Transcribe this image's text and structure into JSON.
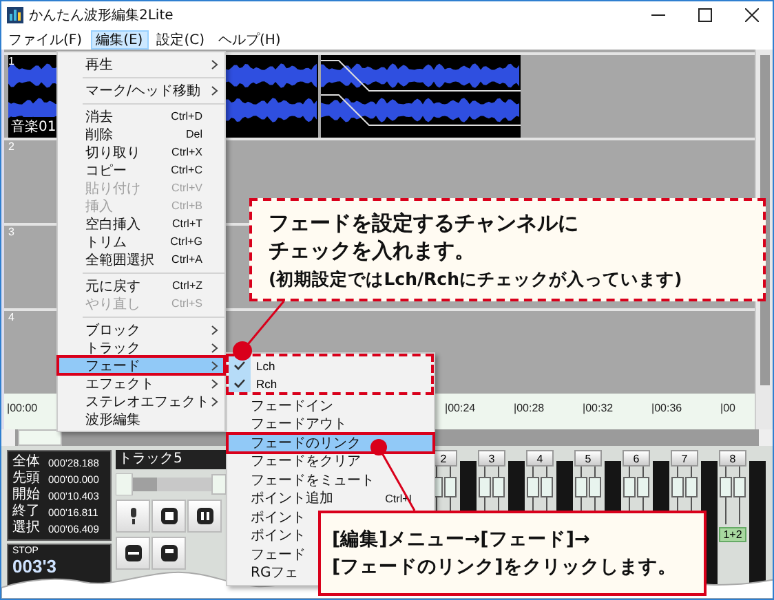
{
  "window": {
    "title": "かんたん波形編集2Lite"
  },
  "menu_bar": [
    {
      "label": "ファイル(F)",
      "selected": false
    },
    {
      "label": "編集(E)",
      "selected": true
    },
    {
      "label": "設定(C)",
      "selected": false
    },
    {
      "label": "ヘルプ(H)",
      "selected": false
    }
  ],
  "tracks": [
    {
      "number": "1",
      "kind": "audio",
      "name": "音楽01"
    },
    {
      "number": "2",
      "kind": "empty"
    },
    {
      "number": "3",
      "kind": "empty"
    },
    {
      "number": "4",
      "kind": "empty"
    }
  ],
  "ruler": [
    "|00:00",
    "|00:24",
    "|00:28",
    "|00:32",
    "|00:36",
    "|00"
  ],
  "info": [
    {
      "label": "全体",
      "value": "000'28.188"
    },
    {
      "label": "先頭",
      "value": "000'00.000"
    },
    {
      "label": "開始",
      "value": "000'10.403"
    },
    {
      "label": "終了",
      "value": "000'16.811"
    },
    {
      "label": "選択",
      "value": "000'06.409"
    }
  ],
  "transport": {
    "state": "STOP",
    "time": "003'3"
  },
  "track_panel": {
    "title": "トラック5"
  },
  "mixer": [
    {
      "channel": "2"
    },
    {
      "channel": "3"
    },
    {
      "channel": "4"
    },
    {
      "channel": "5"
    },
    {
      "channel": "6"
    },
    {
      "channel": "7"
    },
    {
      "channel": "8",
      "mode": "1+2"
    }
  ],
  "edit_menu": [
    {
      "kind": "item",
      "label": "再生",
      "submenu": true,
      "disabled": false,
      "selected": false
    },
    {
      "kind": "separator"
    },
    {
      "kind": "item",
      "label": "マーク/ヘッド移動",
      "submenu": true,
      "disabled": false,
      "selected": false
    },
    {
      "kind": "separator"
    },
    {
      "kind": "item",
      "label": "消去",
      "shortcut": "Ctrl+D",
      "disabled": false,
      "selected": false
    },
    {
      "kind": "item",
      "label": "削除",
      "shortcut": "Del",
      "disabled": false,
      "selected": false
    },
    {
      "kind": "item",
      "label": "切り取り",
      "shortcut": "Ctrl+X",
      "disabled": false,
      "selected": false
    },
    {
      "kind": "item",
      "label": "コピー",
      "shortcut": "Ctrl+C",
      "disabled": false,
      "selected": false
    },
    {
      "kind": "item",
      "label": "貼り付け",
      "shortcut": "Ctrl+V",
      "disabled": true,
      "selected": false
    },
    {
      "kind": "item",
      "label": "挿入",
      "shortcut": "Ctrl+B",
      "disabled": true,
      "selected": false
    },
    {
      "kind": "item",
      "label": "空白挿入",
      "shortcut": "Ctrl+T",
      "disabled": false,
      "selected": false
    },
    {
      "kind": "item",
      "label": "トリム",
      "shortcut": "Ctrl+G",
      "disabled": false,
      "selected": false
    },
    {
      "kind": "item",
      "label": "全範囲選択",
      "shortcut": "Ctrl+A",
      "disabled": false,
      "selected": false
    },
    {
      "kind": "separator"
    },
    {
      "kind": "item",
      "label": "元に戻す",
      "shortcut": "Ctrl+Z",
      "disabled": false,
      "selected": false
    },
    {
      "kind": "item",
      "label": "やり直し",
      "shortcut": "Ctrl+S",
      "disabled": true,
      "selected": false
    },
    {
      "kind": "separator"
    },
    {
      "kind": "item",
      "label": "ブロック",
      "submenu": true,
      "disabled": false,
      "selected": false
    },
    {
      "kind": "item",
      "label": "トラック",
      "submenu": true,
      "disabled": false,
      "selected": false
    },
    {
      "kind": "item",
      "label": "フェード",
      "submenu": true,
      "disabled": false,
      "selected": true
    },
    {
      "kind": "item",
      "label": "エフェクト",
      "submenu": true,
      "disabled": false,
      "selected": false
    },
    {
      "kind": "item",
      "label": "ステレオエフェクト",
      "submenu": true,
      "disabled": false,
      "selected": false
    },
    {
      "kind": "item",
      "label": "波形編集",
      "disabled": false,
      "selected": false
    }
  ],
  "fade_submenu": [
    {
      "kind": "check",
      "label": "Lch",
      "checked": true,
      "selected": false
    },
    {
      "kind": "check",
      "label": "Rch",
      "checked": true,
      "selected": false
    },
    {
      "kind": "item",
      "label": "フェードイン",
      "selected": false
    },
    {
      "kind": "item",
      "label": "フェードアウト",
      "selected": false
    },
    {
      "kind": "item",
      "label": "フェードのリンク",
      "selected": true
    },
    {
      "kind": "item",
      "label": "フェードをクリア",
      "selected": false
    },
    {
      "kind": "item",
      "label": "フェードをミュート",
      "selected": false
    },
    {
      "kind": "item",
      "label": "ポイント追加",
      "shortcut": "Ctrl+I",
      "selected": false
    },
    {
      "kind": "item",
      "label": "ポイント",
      "selected": false
    },
    {
      "kind": "item",
      "label": "ポイント",
      "selected": false
    },
    {
      "kind": "item",
      "label": "フェード",
      "selected": false
    },
    {
      "kind": "item",
      "label": "RGフェ",
      "selected": false
    }
  ],
  "callouts": [
    {
      "kind": "dashed",
      "lines": [
        "フェードを設定するチャンネルに",
        "チェックを入れます。"
      ],
      "note": "(初期設定ではLch/Rchにチェックが入っています)"
    },
    {
      "kind": "solid",
      "lines": [
        "[編集]メニュー→[フェード]→",
        "[フェードのリンク]をクリックします。"
      ]
    }
  ]
}
